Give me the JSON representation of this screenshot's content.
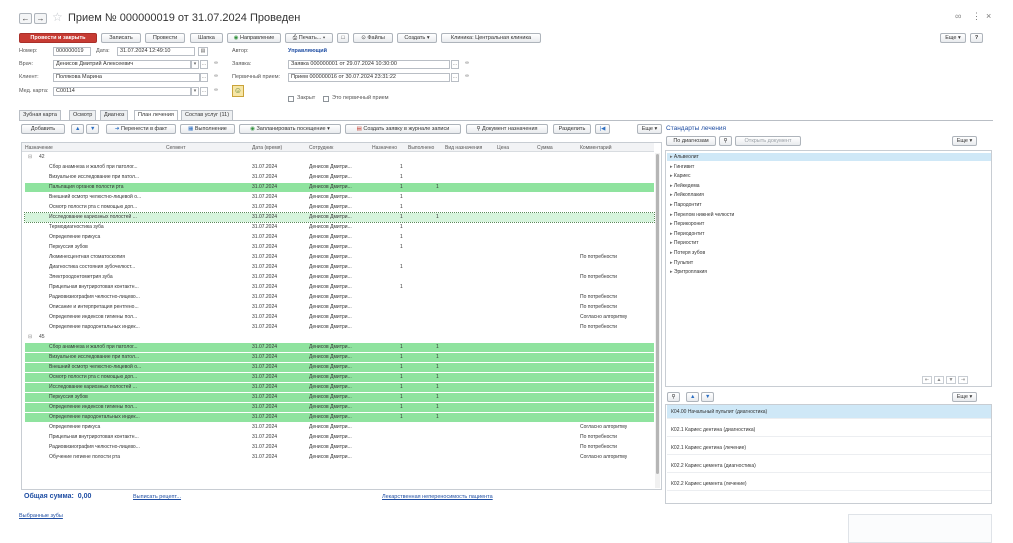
{
  "window": {
    "title": "Прием № 000000019 от 31.07.2024 Проведен",
    "more_label": "Еще",
    "help_label": "?"
  },
  "toolbar": {
    "post_close": "Провести и закрыть",
    "save": "Записать",
    "post": "Провести",
    "hat": "Шапка",
    "referral": "Направление",
    "print": "Печать...",
    "files": "Файлы",
    "create": "Создать",
    "clinic": "Клиника: Центральная клиника"
  },
  "header": {
    "number_label": "Номер:",
    "number": "000000019",
    "date_label": "Дата:",
    "date": "31.07.2024 12:49:10",
    "author_label": "Автор:",
    "author": "Управляющий",
    "doctor_label": "Врач:",
    "doctor": "Денисов Дмитрий Алексеевич",
    "request_label": "Заявка:",
    "request": "Заявка 000000001 от 29.07.2024 10:30:00",
    "client_label": "Клиент:",
    "client": "Полякова Марина",
    "first_visit_label": "Первичный прием:",
    "first_visit": "Прием 000000016 от 30.07.2024 23:31:22",
    "card_label": "Мед. карта:",
    "card": "С00114",
    "closed_label": "Закрыт",
    "is_first_label": "Это первичный прием"
  },
  "tabs": [
    "Зубная карта",
    "Осмотр",
    "Диагноз",
    "План лечения",
    "Состав услуг (11)"
  ],
  "plan_toolbar": {
    "add": "Добавить",
    "move_to_fact": "Перенести в факт",
    "execution": "Выполнение",
    "schedule": "Запланировать посещение",
    "create_request": "Создать заявку в журнале записи",
    "assign_doc": "Документ назначения",
    "split": "Разделить",
    "more": "Еще"
  },
  "columns": [
    "Назначение",
    "Сегмент",
    "Дата (время)",
    "Сотрудник",
    "Назначено",
    "Выполнено",
    "Вид назначения",
    "Цена",
    "Сумма",
    "Комментарий"
  ],
  "groups": [
    {
      "label": "42",
      "rows": [
        {
          "name": "Сбор анамнеза и жалоб при патолог...",
          "date": "31.07.2024",
          "emp": "Денисов Дмитри...",
          "assigned": "1",
          "done": "",
          "comment": "",
          "state": ""
        },
        {
          "name": "Визуальное исследование при патол...",
          "date": "31.07.2024",
          "emp": "Денисов Дмитри...",
          "assigned": "1",
          "done": "",
          "comment": "",
          "state": ""
        },
        {
          "name": "Пальпация органов полости рта",
          "date": "31.07.2024",
          "emp": "Денисов Дмитри...",
          "assigned": "1",
          "done": "1",
          "comment": "",
          "state": "g"
        },
        {
          "name": "Внешний осмотр челюстно-лицевой о...",
          "date": "31.07.2024",
          "emp": "Денисов Дмитри...",
          "assigned": "1",
          "done": "",
          "comment": "",
          "state": ""
        },
        {
          "name": "Осмотр полости рта с помощью доп...",
          "date": "31.07.2024",
          "emp": "Денисов Дмитри...",
          "assigned": "1",
          "done": "",
          "comment": "",
          "state": ""
        },
        {
          "name": "Исследование кариозных полостей ...",
          "date": "31.07.2024",
          "emp": "Денисов Дмитри...",
          "assigned": "1",
          "done": "1",
          "comment": "",
          "state": "sel"
        },
        {
          "name": "Термодиагностика зуба",
          "date": "31.07.2024",
          "emp": "Денисов Дмитри...",
          "assigned": "1",
          "done": "",
          "comment": "",
          "state": ""
        },
        {
          "name": "Определение прикуса",
          "date": "31.07.2024",
          "emp": "Денисов Дмитри...",
          "assigned": "1",
          "done": "",
          "comment": "",
          "state": ""
        },
        {
          "name": "Перкуссия зубов",
          "date": "31.07.2024",
          "emp": "Денисов Дмитри...",
          "assigned": "1",
          "done": "",
          "comment": "",
          "state": ""
        },
        {
          "name": "Люминесцентная стоматоскопия",
          "date": "31.07.2024",
          "emp": "Денисов Дмитри...",
          "assigned": "",
          "done": "",
          "comment": "По потребности",
          "state": ""
        },
        {
          "name": "Диагностика состояния зубочелюст...",
          "date": "31.07.2024",
          "emp": "Денисов Дмитри...",
          "assigned": "1",
          "done": "",
          "comment": "",
          "state": ""
        },
        {
          "name": "Электроодонтометрия зуба",
          "date": "31.07.2024",
          "emp": "Денисов Дмитри...",
          "assigned": "",
          "done": "",
          "comment": "По потребности",
          "state": ""
        },
        {
          "name": "Прицельная внутриротовая контактн...",
          "date": "31.07.2024",
          "emp": "Денисов Дмитри...",
          "assigned": "1",
          "done": "",
          "comment": "",
          "state": ""
        },
        {
          "name": "Радиовизиография челюстно-лицево...",
          "date": "31.07.2024",
          "emp": "Денисов Дмитри...",
          "assigned": "",
          "done": "",
          "comment": "По потребности",
          "state": ""
        },
        {
          "name": "Описание и интерпретация рентгено...",
          "date": "31.07.2024",
          "emp": "Денисов Дмитри...",
          "assigned": "",
          "done": "",
          "comment": "По потребности",
          "state": ""
        },
        {
          "name": "Определение индексов гигиены пол...",
          "date": "31.07.2024",
          "emp": "Денисов Дмитри...",
          "assigned": "",
          "done": "",
          "comment": "Согласно алгоритму",
          "state": ""
        },
        {
          "name": "Определение пародонтальных индек...",
          "date": "31.07.2024",
          "emp": "Денисов Дмитри...",
          "assigned": "",
          "done": "",
          "comment": "По потребности",
          "state": ""
        }
      ]
    },
    {
      "label": "45",
      "rows": [
        {
          "name": "Сбор анамнеза и жалоб при патолог...",
          "date": "31.07.2024",
          "emp": "Денисов Дмитри...",
          "assigned": "1",
          "done": "1",
          "comment": "",
          "state": "g"
        },
        {
          "name": "Визуальное исследование при патол...",
          "date": "31.07.2024",
          "emp": "Денисов Дмитри...",
          "assigned": "1",
          "done": "1",
          "comment": "",
          "state": "g"
        },
        {
          "name": "Внешний осмотр челюстно-лицевой о...",
          "date": "31.07.2024",
          "emp": "Денисов Дмитри...",
          "assigned": "1",
          "done": "1",
          "comment": "",
          "state": "g"
        },
        {
          "name": "Осмотр полости рта с помощью доп...",
          "date": "31.07.2024",
          "emp": "Денисов Дмитри...",
          "assigned": "1",
          "done": "1",
          "comment": "",
          "state": "g"
        },
        {
          "name": "Исследование кариозных полостей ...",
          "date": "31.07.2024",
          "emp": "Денисов Дмитри...",
          "assigned": "1",
          "done": "1",
          "comment": "",
          "state": "g"
        },
        {
          "name": "Перкуссия зубов",
          "date": "31.07.2024",
          "emp": "Денисов Дмитри...",
          "assigned": "1",
          "done": "1",
          "comment": "",
          "state": "g"
        },
        {
          "name": "Определение индексов гигиены пол...",
          "date": "31.07.2024",
          "emp": "Денисов Дмитри...",
          "assigned": "1",
          "done": "1",
          "comment": "",
          "state": "g"
        },
        {
          "name": "Определение пародонтальных индек...",
          "date": "31.07.2024",
          "emp": "Денисов Дмитри...",
          "assigned": "1",
          "done": "1",
          "comment": "",
          "state": "g"
        },
        {
          "name": "Определение прикуса",
          "date": "31.07.2024",
          "emp": "Денисов Дмитри...",
          "assigned": "",
          "done": "",
          "comment": "Согласно алгоритму",
          "state": ""
        },
        {
          "name": "Прицельная внутриротовая контактн...",
          "date": "31.07.2024",
          "emp": "Денисов Дмитри...",
          "assigned": "",
          "done": "",
          "comment": "По потребности",
          "state": ""
        },
        {
          "name": "Радиовизиография челюстно-лицево...",
          "date": "31.07.2024",
          "emp": "Денисов Дмитри...",
          "assigned": "",
          "done": "",
          "comment": "По потребности",
          "state": ""
        },
        {
          "name": "Обучение гигиене полости рта",
          "date": "31.07.2024",
          "emp": "Денисов Дмитри...",
          "assigned": "",
          "done": "",
          "comment": "Согласно алгоритму",
          "state": ""
        }
      ]
    }
  ],
  "footer": {
    "total": "Общая сумма:  0,00",
    "prescription": "Выписать рецепт...",
    "intolerance": "Лекарственная непереносимость пациента",
    "selected_teeth": "Выбранные зубы"
  },
  "standards": {
    "title": "Стандарты лечения",
    "by_diagnosis": "По диагнозам",
    "open_doc": "Открыть документ",
    "more": "Еще",
    "items": [
      "Альвеолит",
      "Гингивит",
      "Кариес",
      "Лейкедема",
      "Лейкоплакия",
      "Пародонтит",
      "Перелом нижней челюсти",
      "Перикоронит",
      "Периодонтит",
      "Периостит",
      "Потеря зубов",
      "Пульпит",
      "Эритроплакия"
    ],
    "diag_more": "Еще",
    "diagnoses": [
      "К04.00 Начальный пульпит (диагностика)",
      "К02.1 Кариес дентина (диагностика)",
      "К02.1 Кариес дентина (лечение)",
      "К02.2 Кариес цемента (диагностика)",
      "К02.2 Кариес цемента (лечение)"
    ]
  },
  "colors": {
    "done_row": "#8fe39f",
    "selected_row": "#d6f4dc",
    "primary_button": "#c73b33",
    "link": "#1f4ea3",
    "selected_item": "#cfe8f7"
  }
}
